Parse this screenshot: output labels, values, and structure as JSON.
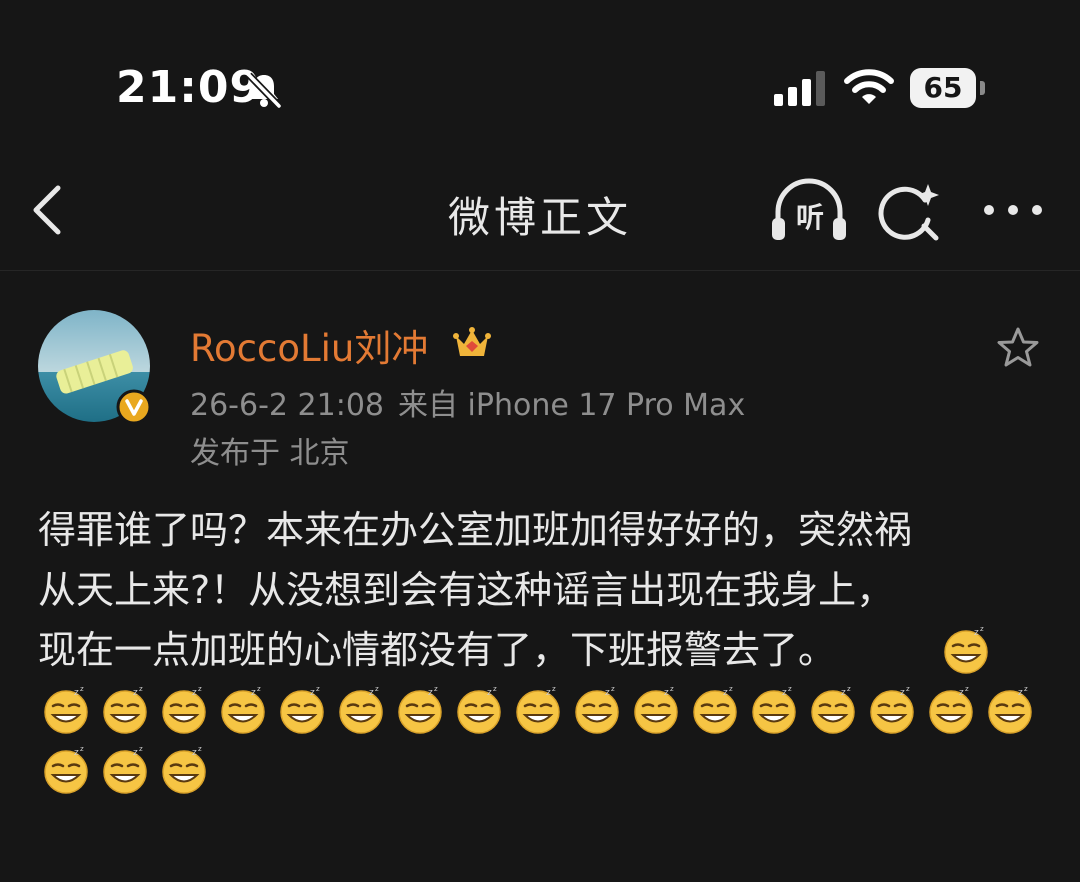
{
  "status_bar": {
    "time": "21:09",
    "battery": "65",
    "icons": [
      "bell-slash-icon",
      "cellular-signal-icon",
      "wifi-icon",
      "battery-icon"
    ]
  },
  "nav": {
    "title": "微博正文",
    "listen_label": "听",
    "icons": [
      "back-chevron-icon",
      "headphones-icon",
      "search-icon",
      "more-icon"
    ]
  },
  "post": {
    "author": "RoccoLiu刘冲",
    "timestamp": "26-6-2 21:08",
    "source": "来自 iPhone 17 Pro Max",
    "location": "发布于 北京",
    "text_lines": [
      "得罪谁了吗？本来在办公室加班加得好好的，突然祸",
      "从天上来?！从没想到会有这种谣言出现在我身上，",
      "现在一点加班的心情都没有了，下班报警去了。"
    ],
    "emoji_name": "sleepy-grin-emoji",
    "emoji_count_total": 21
  },
  "colors": {
    "background": "#161616",
    "username": "#e37a34",
    "meta": "#8e8e8e",
    "text": "#e8e8e8",
    "verified_badge": "#e9a81f",
    "emoji_face": "#f6c544"
  }
}
